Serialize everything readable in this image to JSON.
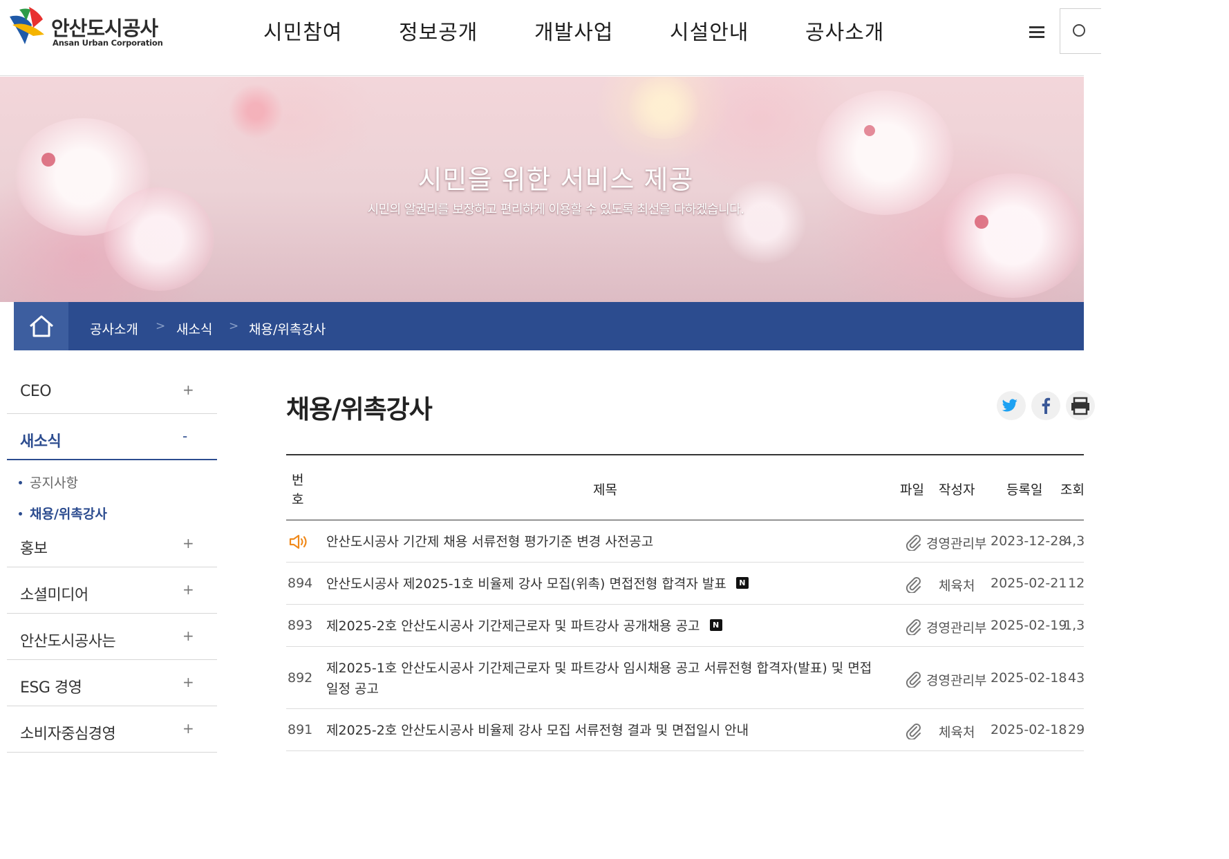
{
  "header": {
    "logo_ko": "안산도시공사",
    "logo_en": "Ansan Urban Corporation",
    "nav": [
      "시민참여",
      "정보공개",
      "개발사업",
      "시설안내",
      "공사소개"
    ]
  },
  "banner": {
    "title": "시민을 위한 서비스 제공",
    "subtitle": "시민의 알권리를 보장하고 편리하게 이용할 수 있도록 최선을 다하겠습니다."
  },
  "breadcrumb": [
    "공사소개",
    "새소식",
    "채용/위촉강사"
  ],
  "breadcrumb_sep": ">",
  "sidebar": {
    "items": [
      {
        "label": "CEO",
        "toggle": "+"
      },
      {
        "label": "새소식",
        "toggle": "-"
      },
      {
        "label": "홍보",
        "toggle": "+"
      },
      {
        "label": "소셜미디어",
        "toggle": "+"
      },
      {
        "label": "안산도시공사는",
        "toggle": "+"
      },
      {
        "label": "ESG 경영",
        "toggle": "+"
      },
      {
        "label": "소비자중심경영",
        "toggle": "+"
      }
    ],
    "subitems": [
      "공지사항",
      "채용/위촉강사"
    ]
  },
  "page": {
    "title": "채용/위촉강사"
  },
  "table": {
    "headers": {
      "no": "번호",
      "title": "제목",
      "file": "파일",
      "author": "작성자",
      "date": "등록일",
      "views": "조회"
    },
    "rows": [
      {
        "no": "",
        "notice": true,
        "title": "안산도시공사 기간제 채용 서류전형 평가기준 변경 사전공고",
        "new": false,
        "author": "경영관리부",
        "date": "2023-12-28",
        "views": "4,3"
      },
      {
        "no": "894",
        "notice": false,
        "title": "안산도시공사 제2025-1호 비율제 강사 모집(위촉) 면접전형 합격자 발표",
        "new": true,
        "new_label": "N",
        "author": "체육처",
        "date": "2025-02-21",
        "views": "12"
      },
      {
        "no": "893",
        "notice": false,
        "title": "제2025-2호 안산도시공사 기간제근로자 및 파트강사 공개채용 공고",
        "new": true,
        "new_label": "N",
        "author": "경영관리부",
        "date": "2025-02-19",
        "views": "1,3"
      },
      {
        "no": "892",
        "notice": false,
        "title": "제2025-1호 안산도시공사 기간제근로자 및 파트강사 임시채용 공고 서류전형 합격자(발표) 및 면접일정 공고",
        "new": false,
        "author": "경영관리부",
        "date": "2025-02-18",
        "views": "43"
      },
      {
        "no": "891",
        "notice": false,
        "title": "제2025-2호 안산도시공사 비율제 강사 모집 서류전형 결과 및 면접일시 안내",
        "new": false,
        "author": "체육처",
        "date": "2025-02-18",
        "views": "29"
      }
    ]
  },
  "colors": {
    "brand_blue": "#2c4c8f",
    "notice_orange": "#f08a1c"
  }
}
